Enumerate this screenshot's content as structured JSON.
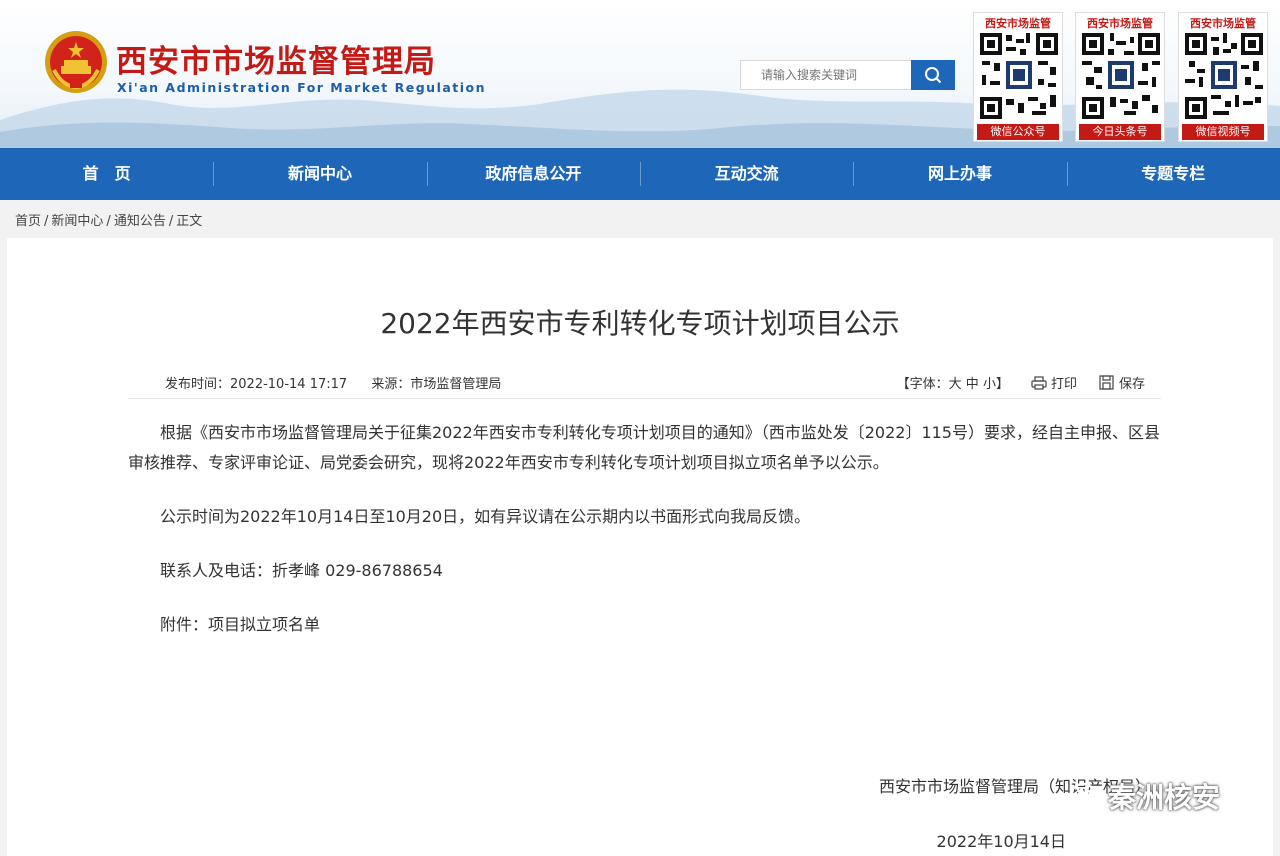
{
  "header": {
    "site_title": "西安市市场监督管理局",
    "site_subtitle": "Xi'an Administration For Market Regulation",
    "search_placeholder": "请输入搜索关键词",
    "qr_codes": [
      {
        "title": "西安市场监管",
        "label": "微信公众号"
      },
      {
        "title": "西安市场监管",
        "label": "今日头条号"
      },
      {
        "title": "西安市场监管",
        "label": "微信视频号"
      }
    ]
  },
  "nav": [
    "首　页",
    "新闻中心",
    "政府信息公开",
    "互动交流",
    "网上办事",
    "专题专栏"
  ],
  "breadcrumb": [
    "首页",
    "新闻中心",
    "通知公告",
    "正文"
  ],
  "breadcrumb_sep": "/",
  "article": {
    "title": "2022年西安市专利转化专项计划项目公示",
    "publish_label": "发布时间：",
    "publish_time": "2022-10-14 17:17",
    "source_label": "来源：",
    "source": "市场监督管理局",
    "font_label_open": "【字体：",
    "font_sizes": [
      "大",
      "中",
      "小"
    ],
    "font_label_close": "】",
    "print_label": "打印",
    "save_label": "保存",
    "paragraphs": [
      "根据《西安市市场监督管理局关于征集2022年西安市专利转化专项计划项目的通知》（西市监处发〔2022〕115号）要求，经自主申报、区县审核推荐、专家评审论证、局党委会研究，现将2022年西安市专利转化专项计划项目拟立项名单予以公示。",
      "公示时间为2022年10月14日至10月20日，如有异议请在公示期内以书面形式向我局反馈。",
      "联系人及电话：折孝峰 029-86788654",
      "附件：项目拟立项名单"
    ],
    "signature": "西安市市场监督管理局（知识产权局）",
    "date": "2022年10月14日"
  },
  "watermark": "秦洲核安",
  "colors": {
    "brand_red": "#c41a16",
    "nav_blue": "#1e66b7"
  }
}
